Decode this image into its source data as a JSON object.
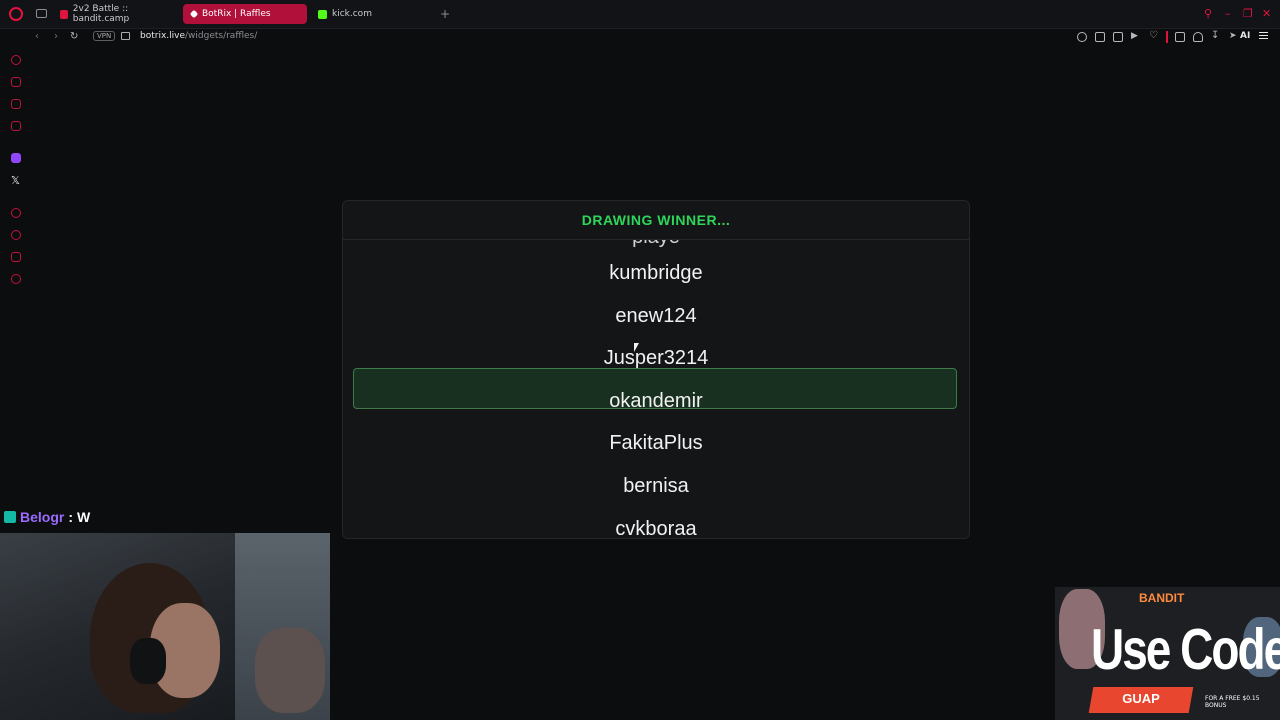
{
  "browser": {
    "tabs": [
      {
        "label": "2v2 Battle :: bandit.camp"
      },
      {
        "label": "BotRix | Raffles"
      },
      {
        "label": "kick.com"
      }
    ],
    "new_tab_symbol": "+",
    "address": {
      "vpn_label": "VPN",
      "host": "botrix.live",
      "path": "/widgets/raffles/"
    },
    "toolbar_ai_label": "AI",
    "accent_color": "#e0143f"
  },
  "raffle": {
    "header": "DRAWING WINNER...",
    "header_color": "#2fd65b",
    "names": [
      "kumbridge",
      "enew124",
      "Jusper3214",
      "okandemir",
      "FakitaPlus",
      "bernisa",
      "cvkboraa"
    ],
    "highlighted_name": "okandemir"
  },
  "chat": {
    "username": "Belogr",
    "separator": ":",
    "message": "W"
  },
  "ad": {
    "brand": "BANDIT",
    "headline": "Use Code",
    "code": "GUAP",
    "promo": "FOR A FREE $0.15 BONUS"
  }
}
